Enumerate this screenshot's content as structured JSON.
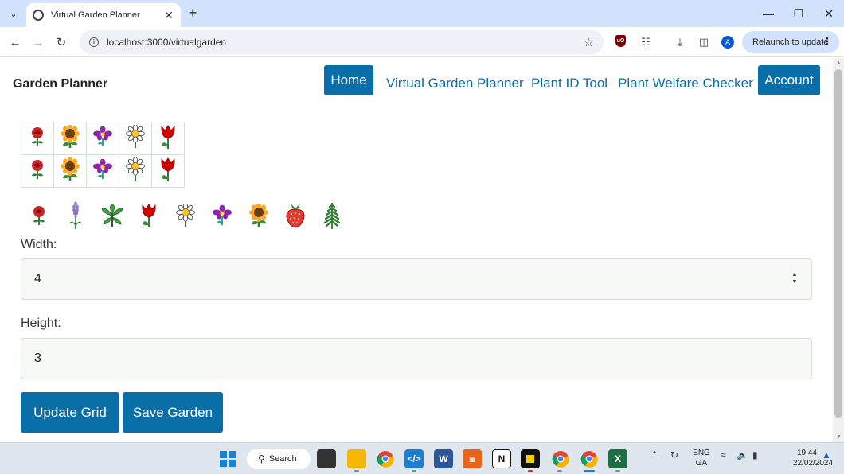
{
  "browser": {
    "tab_title": "Virtual Garden Planner",
    "url": "localhost:3000/virtualgarden",
    "relaunch_label": "Relaunch to update",
    "profile_initial": "A",
    "ublock_label": "uO"
  },
  "site": {
    "brand": "Garden Planner",
    "nav": {
      "home": "Home",
      "virtual_garden_planner": "Virtual Garden Planner",
      "plant_id_tool": "Plant ID Tool",
      "plant_welfare_checker": "Plant Welfare Checker",
      "account": "Account"
    },
    "accent_color": "#0a6ea8"
  },
  "garden_grid": {
    "columns": 5,
    "rows": 2,
    "cells": [
      [
        "rose",
        "sunflower",
        "orchid",
        "daisy",
        "tulip"
      ],
      [
        "rose",
        "sunflower",
        "orchid",
        "daisy",
        "tulip"
      ]
    ]
  },
  "palette": [
    "rose",
    "lavender",
    "basil",
    "tulip",
    "daisy",
    "orchid",
    "sunflower",
    "strawberry",
    "fern"
  ],
  "form": {
    "width_label": "Width:",
    "width_value": "4",
    "height_label": "Height:",
    "height_value": "3",
    "update_button": "Update Grid",
    "save_button": "Save Garden"
  },
  "taskbar": {
    "search_label": "Search",
    "lang_line1": "ENG",
    "lang_line2": "GA",
    "time": "19:44",
    "date": "22/02/2024",
    "apps": [
      "start-menu",
      "search",
      "task-view",
      "file-explorer",
      "chrome",
      "vscode",
      "word",
      "calendar-app",
      "notion",
      "sticky-notes",
      "chrome-profile-1",
      "chrome-profile-2",
      "excel"
    ]
  }
}
